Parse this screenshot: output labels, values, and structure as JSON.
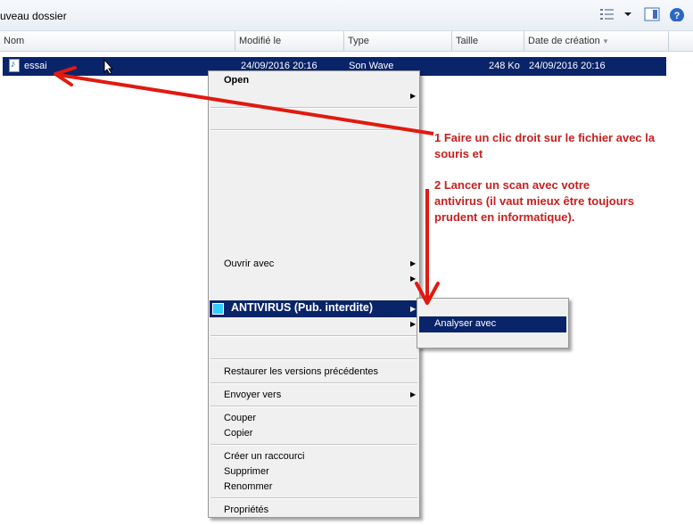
{
  "toolbar": {
    "breadcrumb": "uveau dossier"
  },
  "columns": [
    "Nom",
    "Modifié le",
    "Type",
    "Taille",
    "Date de création"
  ],
  "file": {
    "name": "essai",
    "modified": "24/09/2016 20:16",
    "type": "Son Wave",
    "size": "248 Ko",
    "created": "24/09/2016 20:16"
  },
  "menu": {
    "open": "Open",
    "open_with": "Ouvrir avec",
    "antivirus": "ANTIVIRUS (Pub. interdite)",
    "restore": "Restaurer les versions précédentes",
    "send_to": "Envoyer vers",
    "cut": "Couper",
    "copy": "Copier",
    "shortcut": "Créer un raccourci",
    "delete": "Supprimer",
    "rename": "Renommer",
    "properties": "Propriétés"
  },
  "submenu": {
    "scan": "Analyser avec"
  },
  "annotations": {
    "step1_line1": "1 Faire un clic droit sur le fichier avec la",
    "step1_line2": "souris et",
    "step2_line1": "2 Lancer un scan avec votre",
    "step2_line2": "antivirus (il vaut mieux être toujours",
    "step2_line3": "prudent en informatique)."
  },
  "colors": {
    "selection": "#0a246a",
    "annotation": "#e01a10",
    "antivirus_square": "#33ccff"
  }
}
